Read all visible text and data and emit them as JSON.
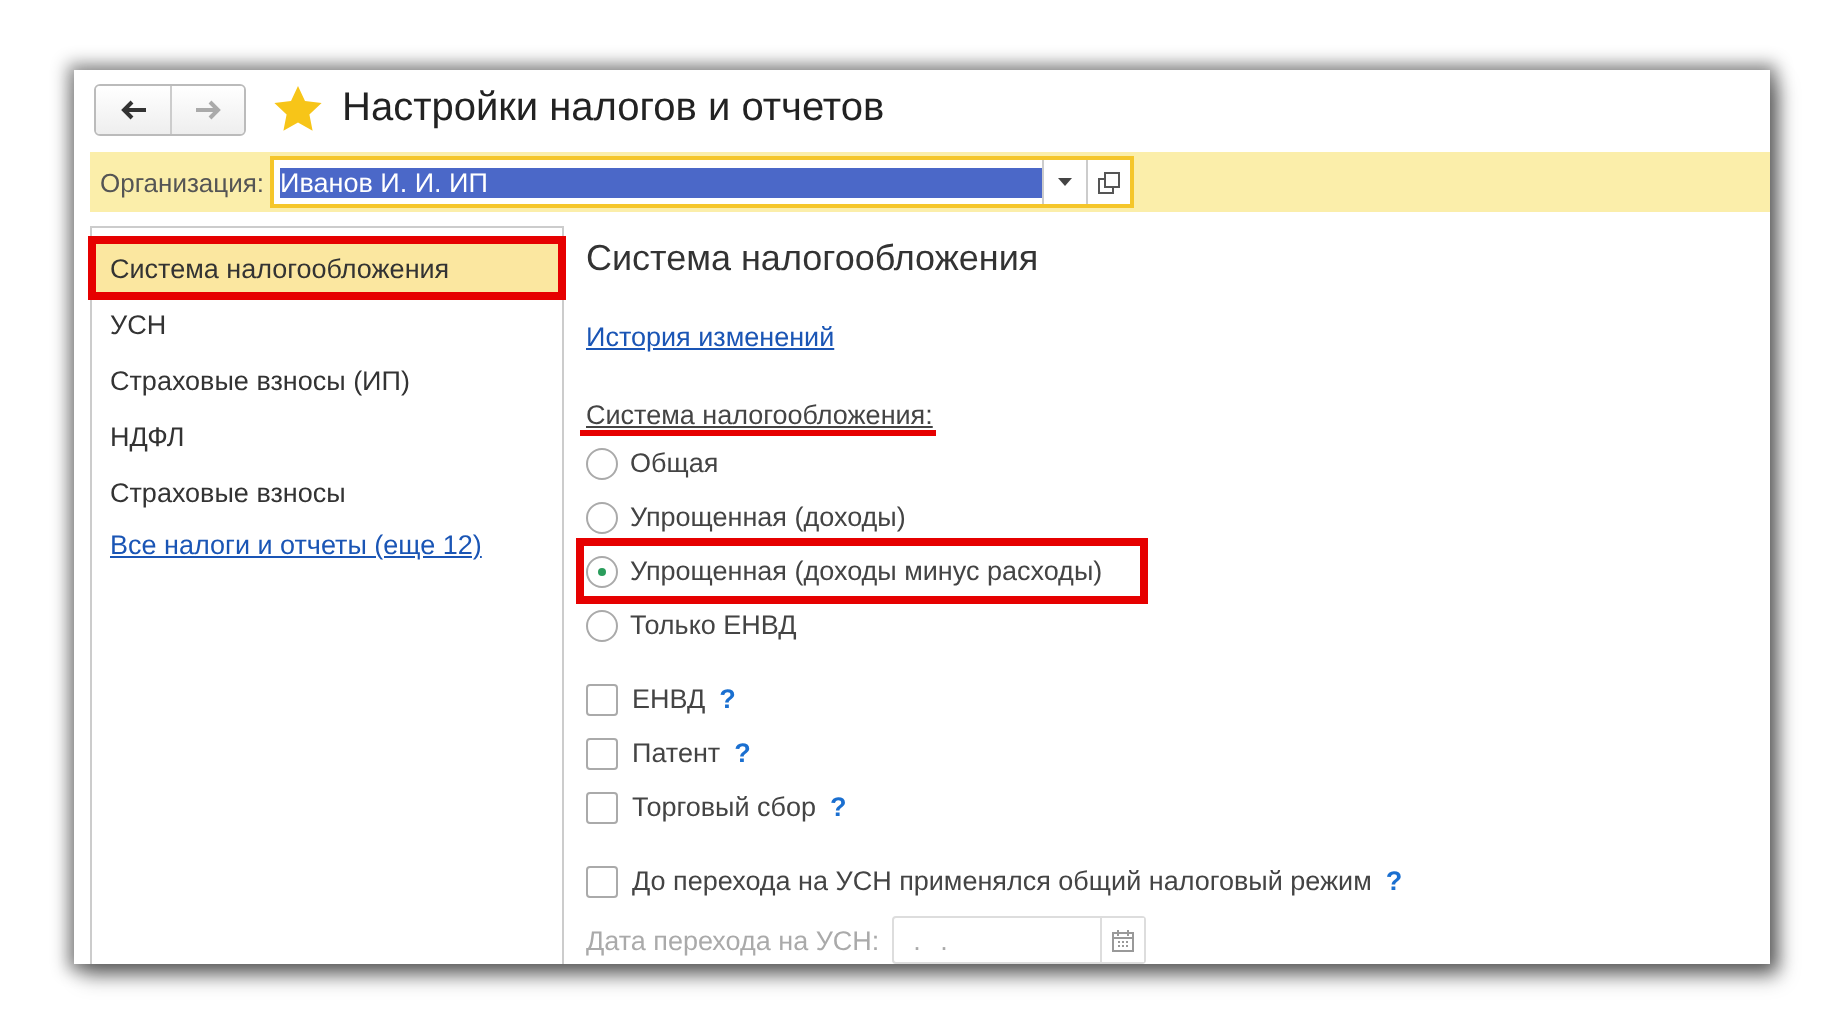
{
  "window": {
    "title": "Настройки налогов и отчетов"
  },
  "organization": {
    "label": "Организация:",
    "value": "Иванов И. И. ИП"
  },
  "sidebar": {
    "items": [
      {
        "label": "Система налогообложения",
        "selected": true,
        "annotated": true
      },
      {
        "label": "УСН",
        "selected": false,
        "annotated": false
      },
      {
        "label": "Страховые взносы (ИП)",
        "selected": false,
        "annotated": false
      },
      {
        "label": "НДФЛ",
        "selected": false,
        "annotated": false
      },
      {
        "label": "Страховые взносы",
        "selected": false,
        "annotated": false
      }
    ],
    "link": "Все налоги и отчеты (еще 12)"
  },
  "content": {
    "heading": "Система налогообложения",
    "history_link": "История изменений",
    "tax_system": {
      "label": "Система налогообложения:",
      "annotated": true,
      "options": [
        {
          "label": "Общая",
          "selected": false,
          "annotated": false
        },
        {
          "label": "Упрощенная (доходы)",
          "selected": false,
          "annotated": false
        },
        {
          "label": "Упрощенная (доходы минус расходы)",
          "selected": true,
          "annotated": true
        },
        {
          "label": "Только ЕНВД",
          "selected": false,
          "annotated": false
        }
      ]
    },
    "checkboxes": [
      {
        "label": "ЕНВД",
        "checked": false,
        "help": "?"
      },
      {
        "label": "Патент",
        "checked": false,
        "help": "?"
      },
      {
        "label": "Торговый сбор",
        "checked": false,
        "help": "?"
      }
    ],
    "transition_checkbox": {
      "label": "До перехода на УСН применялся общий налоговый режим",
      "checked": false,
      "help": "?"
    },
    "transition_date": {
      "label": "Дата перехода на УСН:",
      "value": ". .",
      "disabled": true
    }
  }
}
